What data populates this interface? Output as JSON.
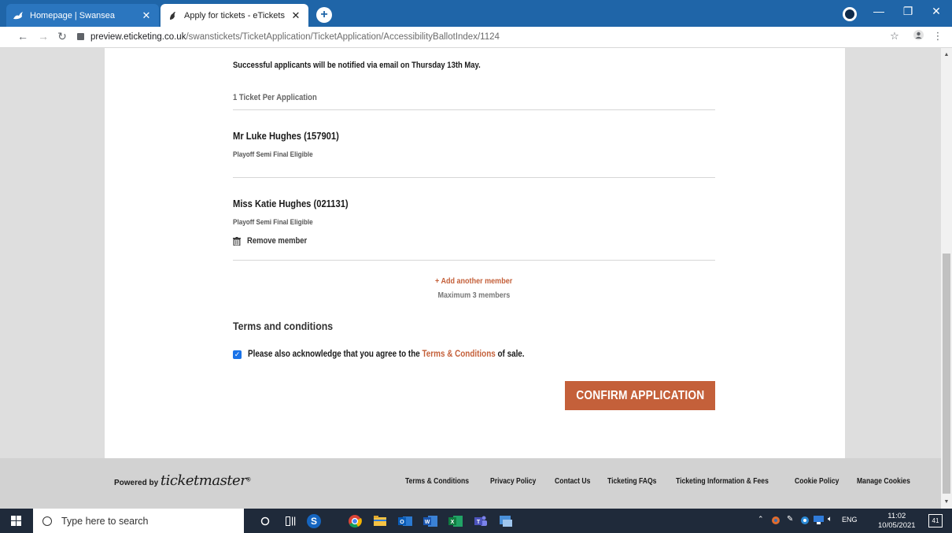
{
  "browser": {
    "tabs": [
      {
        "title": "Homepage | Swansea",
        "active": false
      },
      {
        "title": "Apply for tickets - eTickets",
        "active": true
      }
    ],
    "url_host": "preview.eticketing.co.uk",
    "url_path": "/swanstickets/TicketApplication/TicketApplication/AccessibilityBallotIndex/1124"
  },
  "page": {
    "notify_text": "Successful applicants will be notified via email on Thursday 13th May.",
    "per_application": "1 Ticket Per Application",
    "members": [
      {
        "name": "Mr Luke Hughes (157901)",
        "status": "Playoff Semi Final Eligible"
      },
      {
        "name": "Miss Katie Hughes (021131)",
        "status": "Playoff Semi Final Eligible",
        "remove_label": "Remove member"
      }
    ],
    "add_member": "+ Add another member",
    "max_members": "Maximum 3 members",
    "terms_title": "Terms and conditions",
    "acknowledge": {
      "checked": true,
      "before": "Please also acknowledge that you agree to the ",
      "link": "Terms & Conditions",
      "after": " of sale."
    },
    "confirm_label": "CONFIRM APPLICATION",
    "accent_color": "#c4603a"
  },
  "footer": {
    "powered_by": "Powered by",
    "brand": "ticketmaster",
    "links": [
      "Terms & Conditions",
      "Privacy Policy",
      "Contact Us",
      "Ticketing FAQs",
      "Ticketing Information & Fees",
      "Cookie Policy",
      "Manage Cookies"
    ]
  },
  "taskbar": {
    "search_placeholder": "Type here to search",
    "language": "ENG",
    "time": "11:02",
    "date": "10/05/2021",
    "notification_count": "41"
  }
}
